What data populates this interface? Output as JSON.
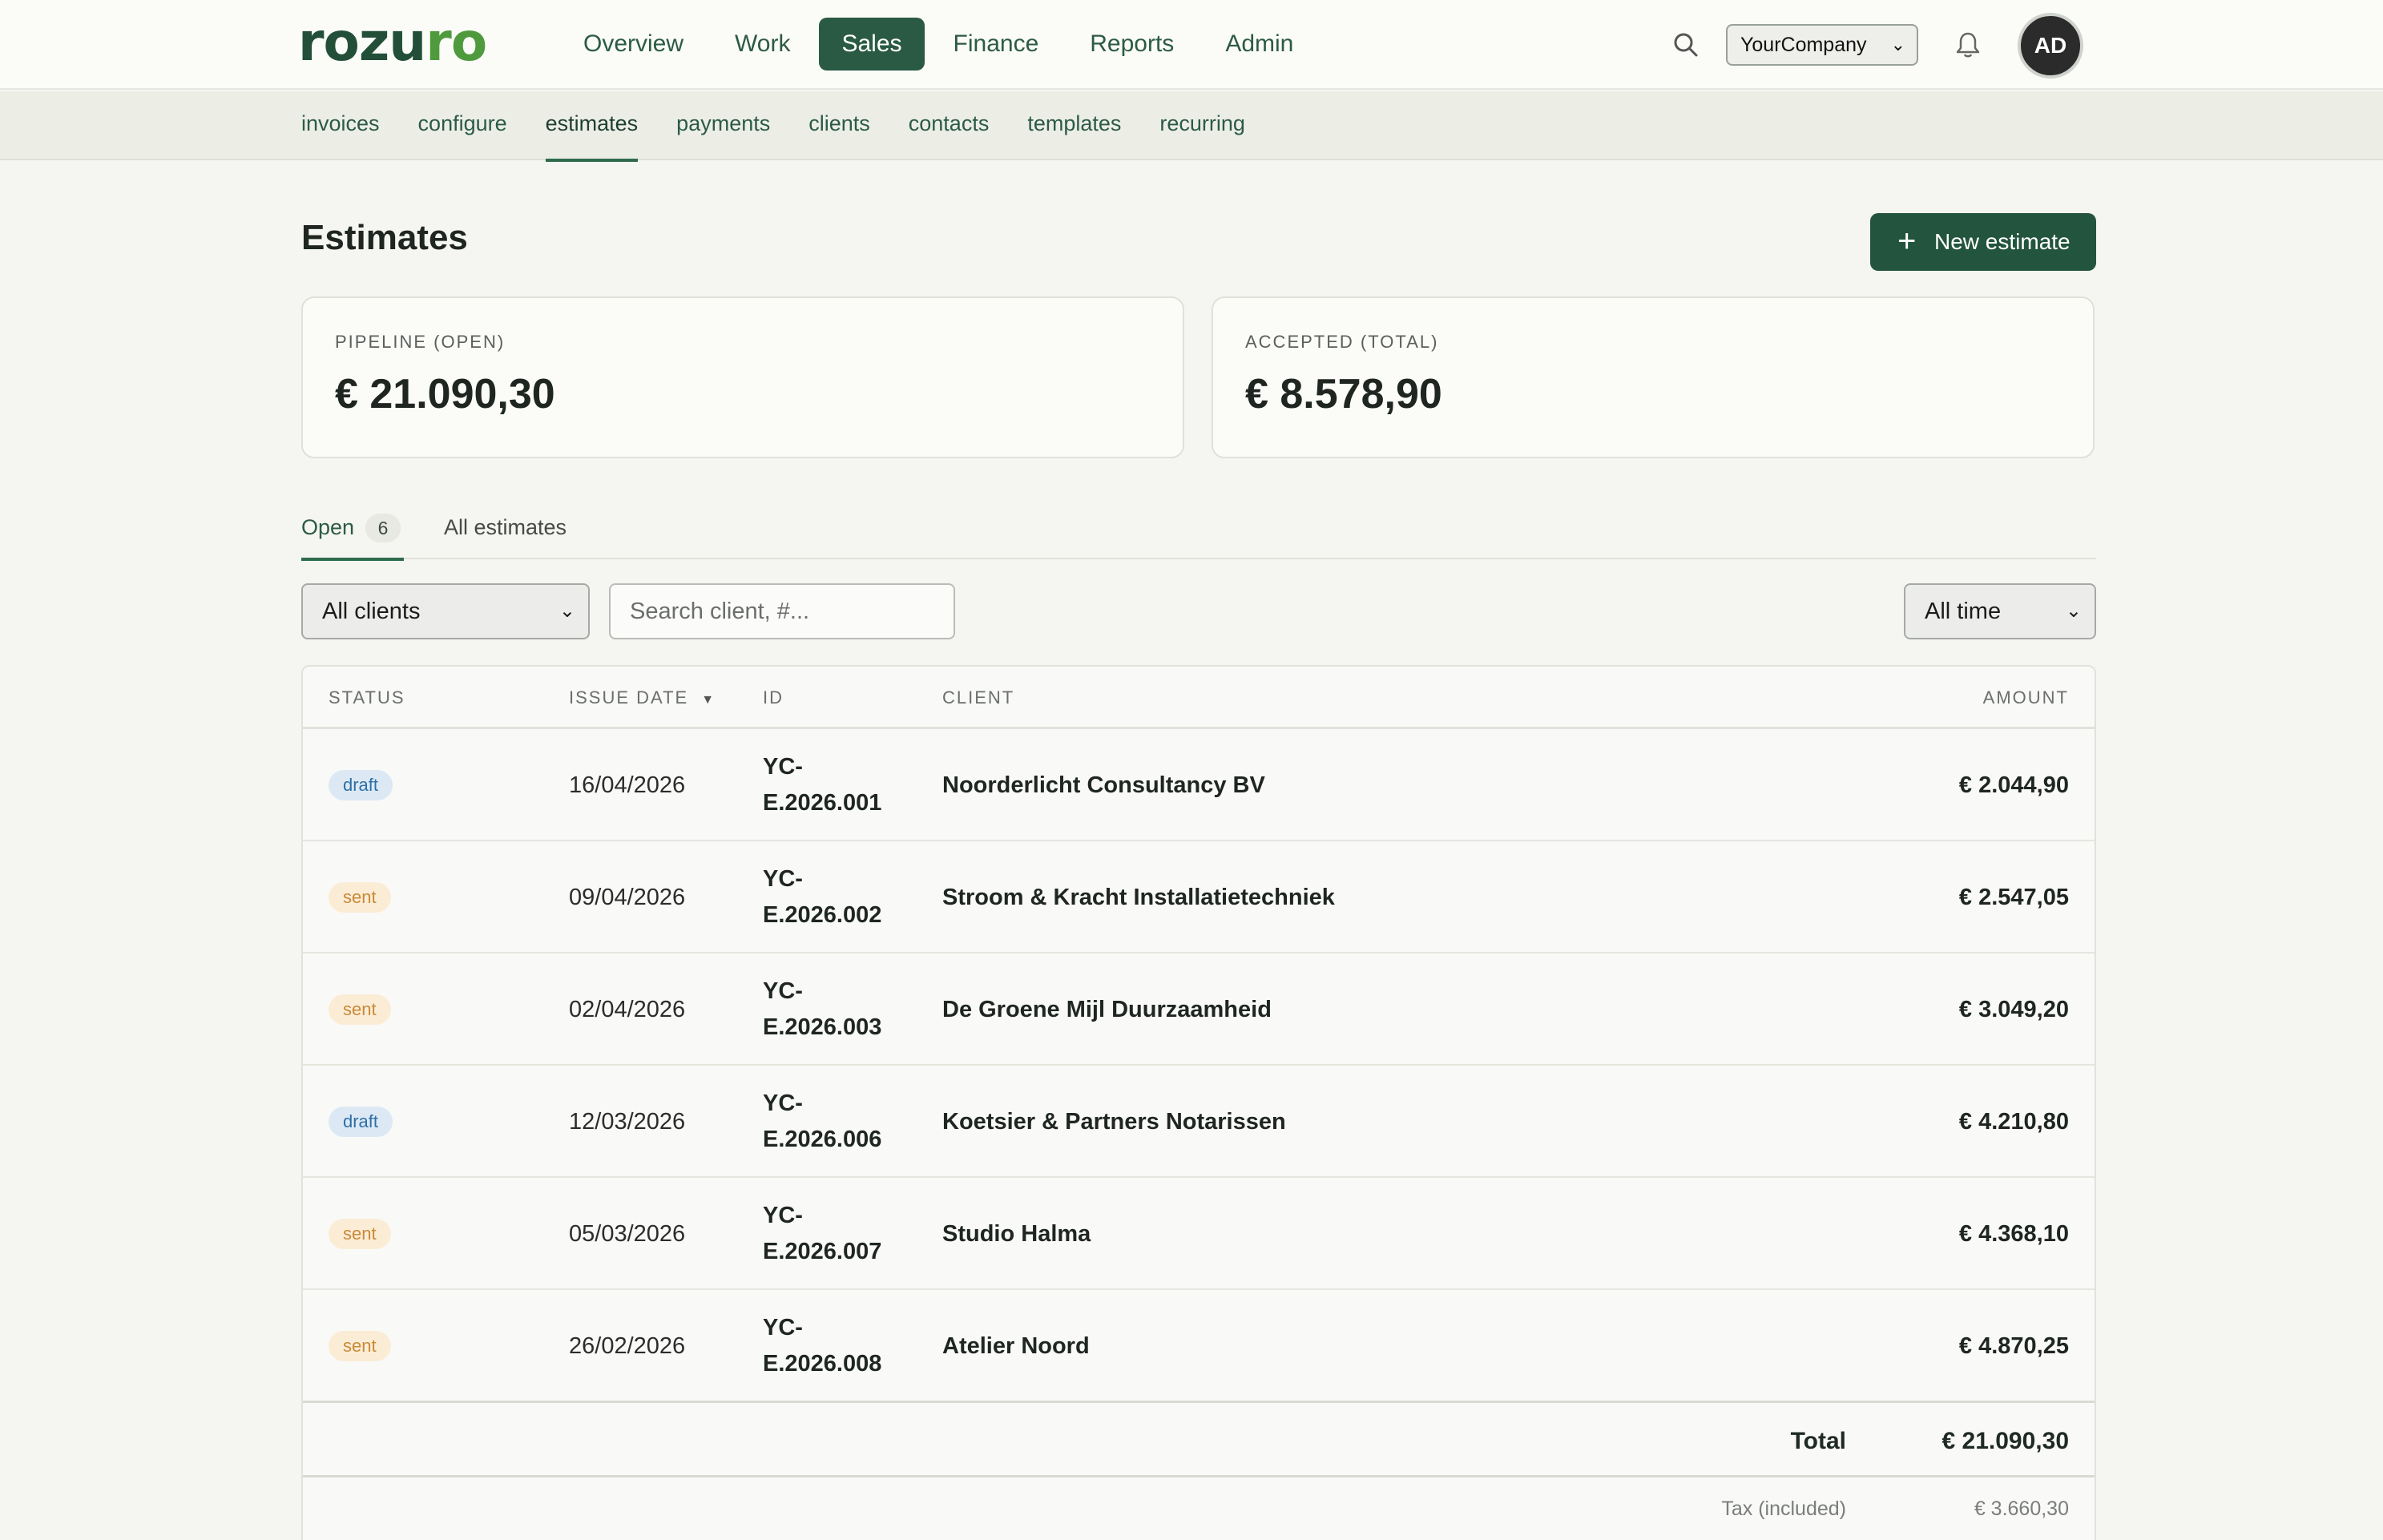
{
  "app": {
    "logo_pre": "rozu",
    "logo_accent": "ro",
    "brand_color": "#234f38",
    "accent_color": "#4f9a3d"
  },
  "mainnav": [
    {
      "label": "Overview",
      "active": false
    },
    {
      "label": "Work",
      "active": false
    },
    {
      "label": "Sales",
      "active": true
    },
    {
      "label": "Finance",
      "active": false
    },
    {
      "label": "Reports",
      "active": false
    },
    {
      "label": "Admin",
      "active": false
    }
  ],
  "header": {
    "company": "YourCompany",
    "avatar_initials": "AD",
    "search_icon": "search-icon",
    "bell_icon": "bell-icon"
  },
  "subnav": [
    {
      "label": "invoices",
      "active": false
    },
    {
      "label": "configure",
      "active": false
    },
    {
      "label": "estimates",
      "active": true
    },
    {
      "label": "payments",
      "active": false
    },
    {
      "label": "clients",
      "active": false
    },
    {
      "label": "contacts",
      "active": false
    },
    {
      "label": "templates",
      "active": false
    },
    {
      "label": "recurring",
      "active": false
    }
  ],
  "page": {
    "title": "Estimates",
    "new_button": "New estimate"
  },
  "stats": [
    {
      "label": "PIPELINE (OPEN)",
      "value": "€ 21.090,30"
    },
    {
      "label": "ACCEPTED (TOTAL)",
      "value": "€ 8.578,90"
    }
  ],
  "tabs": {
    "open_label": "Open",
    "open_count": "6",
    "all_label": "All estimates"
  },
  "filters": {
    "client_select": "All clients",
    "search_placeholder": "Search client, #...",
    "time_select": "All time"
  },
  "table": {
    "columns": {
      "status": "STATUS",
      "date": "ISSUE DATE",
      "id": "ID",
      "client": "CLIENT",
      "amount": "AMOUNT"
    },
    "rows": [
      {
        "status": "draft",
        "date": "16/04/2026",
        "id_a": "YC-",
        "id_b": "E.2026.001",
        "client": "Noorderlicht Consultancy BV",
        "amount": "€ 2.044,90"
      },
      {
        "status": "sent",
        "date": "09/04/2026",
        "id_a": "YC-",
        "id_b": "E.2026.002",
        "client": "Stroom & Kracht Installatietechniek",
        "amount": "€ 2.547,05"
      },
      {
        "status": "sent",
        "date": "02/04/2026",
        "id_a": "YC-",
        "id_b": "E.2026.003",
        "client": "De Groene Mijl Duurzaamheid",
        "amount": "€ 3.049,20"
      },
      {
        "status": "draft",
        "date": "12/03/2026",
        "id_a": "YC-",
        "id_b": "E.2026.006",
        "client": "Koetsier & Partners Notarissen",
        "amount": "€ 4.210,80"
      },
      {
        "status": "sent",
        "date": "05/03/2026",
        "id_a": "YC-",
        "id_b": "E.2026.007",
        "client": "Studio Halma",
        "amount": "€ 4.368,10"
      },
      {
        "status": "sent",
        "date": "26/02/2026",
        "id_a": "YC-",
        "id_b": "E.2026.008",
        "client": "Atelier Noord",
        "amount": "€ 4.870,25"
      }
    ],
    "total_label": "Total",
    "total_value": "€ 21.090,30",
    "tax_label": "Tax (included)",
    "tax_value": "€ 3.660,30"
  }
}
